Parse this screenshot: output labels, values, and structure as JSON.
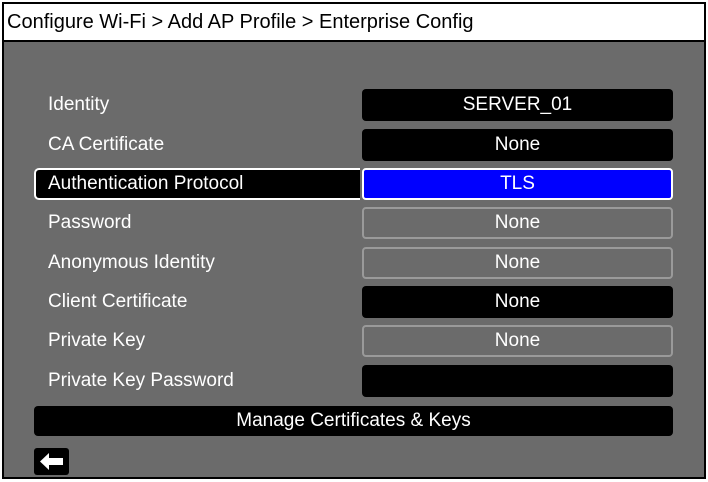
{
  "header": {
    "breadcrumb": "Configure Wi-Fi > Add AP Profile > Enterprise Config"
  },
  "fields": [
    {
      "label": "Identity",
      "value": "SERVER_01",
      "style": "filled"
    },
    {
      "label": "CA Certificate",
      "value": "None",
      "style": "filled"
    },
    {
      "label": "Authentication Protocol",
      "value": "TLS",
      "style": "active",
      "selected": true
    },
    {
      "label": "Password",
      "value": "None",
      "style": "outlined"
    },
    {
      "label": "Anonymous Identity",
      "value": "None",
      "style": "outlined"
    },
    {
      "label": "Client Certificate",
      "value": "None",
      "style": "filled"
    },
    {
      "label": "Private Key",
      "value": "None",
      "style": "outlined"
    },
    {
      "label": "Private Key Password",
      "value": "",
      "style": "filled"
    }
  ],
  "footer": {
    "manage_label": "Manage Certificates & Keys",
    "back_icon": "back-arrow-icon"
  },
  "colors": {
    "background": "#6b6b6b",
    "selected_value": "#0000ff",
    "field": "#000000",
    "text": "#ffffff"
  }
}
